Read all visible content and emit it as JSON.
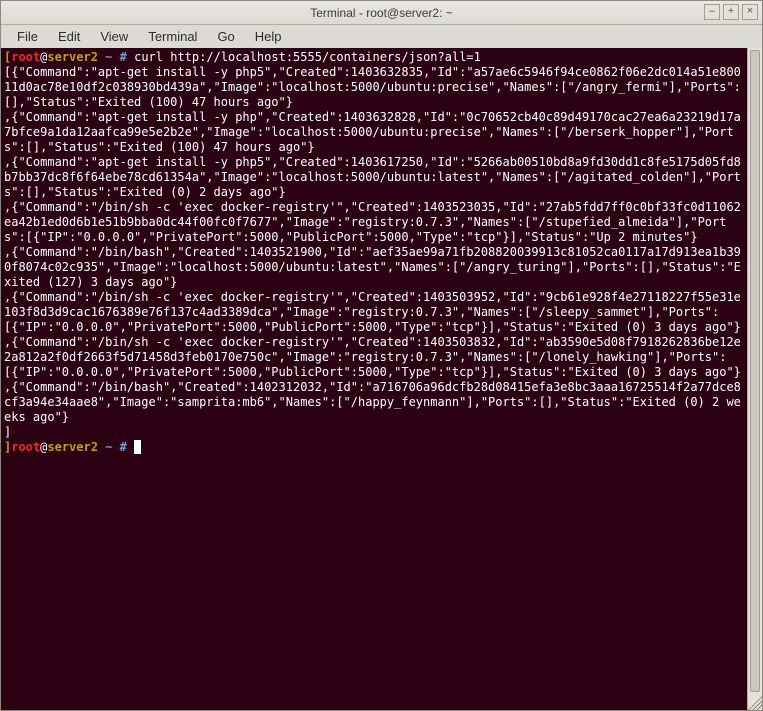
{
  "window": {
    "title": "Terminal - root@server2: ~"
  },
  "menu": {
    "file": "File",
    "edit": "Edit",
    "view": "View",
    "terminal": "Terminal",
    "go": "Go",
    "help": "Help"
  },
  "winbtns": {
    "min": "–",
    "max": "+",
    "close": "×"
  },
  "prompt": {
    "open_br": "[",
    "user": "root",
    "at": "@",
    "host": "server2",
    "path": " ~ ",
    "hash": "#",
    "close_br": "]"
  },
  "command": " curl http://localhost:5555/containers/json?all=1",
  "output": "[{\"Command\":\"apt-get install -y php5\",\"Created\":1403632835,\"Id\":\"a57ae6c5946f94ce0862f06e2dc014a51e80011d0ac78e10df2c038930bd439a\",\"Image\":\"localhost:5000/ubuntu:precise\",\"Names\":[\"/angry_fermi\"],\"Ports\":[],\"Status\":\"Exited (100) 47 hours ago\"}\n,{\"Command\":\"apt-get install -y php\",\"Created\":1403632828,\"Id\":\"0c70652cb40c89d49170cac27ea6a23219d17a7bfce9a1da12aafca99e5e2b2e\",\"Image\":\"localhost:5000/ubuntu:precise\",\"Names\":[\"/berserk_hopper\"],\"Ports\":[],\"Status\":\"Exited (100) 47 hours ago\"}\n,{\"Command\":\"apt-get install -y php5\",\"Created\":1403617250,\"Id\":\"5266ab00510bd8a9fd30dd1c8fe5175d05fd8b7bb37dc8f6f64ebe78cd61354a\",\"Image\":\"localhost:5000/ubuntu:latest\",\"Names\":[\"/agitated_colden\"],\"Ports\":[],\"Status\":\"Exited (0) 2 days ago\"}\n,{\"Command\":\"/bin/sh -c 'exec docker-registry'\",\"Created\":1403523035,\"Id\":\"27ab5fdd7ff0c0bf33fc0d11062ea42b1ed0d6b1e51b9bba0dc44f00fc0f7677\",\"Image\":\"registry:0.7.3\",\"Names\":[\"/stupefied_almeida\"],\"Ports\":[{\"IP\":\"0.0.0.0\",\"PrivatePort\":5000,\"PublicPort\":5000,\"Type\":\"tcp\"}],\"Status\":\"Up 2 minutes\"}\n,{\"Command\":\"/bin/bash\",\"Created\":1403521900,\"Id\":\"aef35ae99a71fb208820039913c81052ca0117a17d913ea1b390f8074c02c935\",\"Image\":\"localhost:5000/ubuntu:latest\",\"Names\":[\"/angry_turing\"],\"Ports\":[],\"Status\":\"Exited (127) 3 days ago\"}\n,{\"Command\":\"/bin/sh -c 'exec docker-registry'\",\"Created\":1403503952,\"Id\":\"9cb61e928f4e27118227f55e31e103f8d3d9cac1676389e76f137c4ad3389dca\",\"Image\":\"registry:0.7.3\",\"Names\":[\"/sleepy_sammet\"],\"Ports\":[{\"IP\":\"0.0.0.0\",\"PrivatePort\":5000,\"PublicPort\":5000,\"Type\":\"tcp\"}],\"Status\":\"Exited (0) 3 days ago\"}\n,{\"Command\":\"/bin/sh -c 'exec docker-registry'\",\"Created\":1403503832,\"Id\":\"ab3590e5d08f7918262836be12e2a812a2f0df2663f5d71458d3feb0170e750c\",\"Image\":\"registry:0.7.3\",\"Names\":[\"/lonely_hawking\"],\"Ports\":[{\"IP\":\"0.0.0.0\",\"PrivatePort\":5000,\"PublicPort\":5000,\"Type\":\"tcp\"}],\"Status\":\"Exited (0) 3 days ago\"}\n,{\"Command\":\"/bin/bash\",\"Created\":1402312032,\"Id\":\"a716706a96dcfb28d08415efa3e8bc3aaa16725514f2a77dce8cf3a94e34aae8\",\"Image\":\"samprita:mb6\",\"Names\":[\"/happy_feynmann\"],\"Ports\":[],\"Status\":\"Exited (0) 2 weeks ago\"}\n]"
}
